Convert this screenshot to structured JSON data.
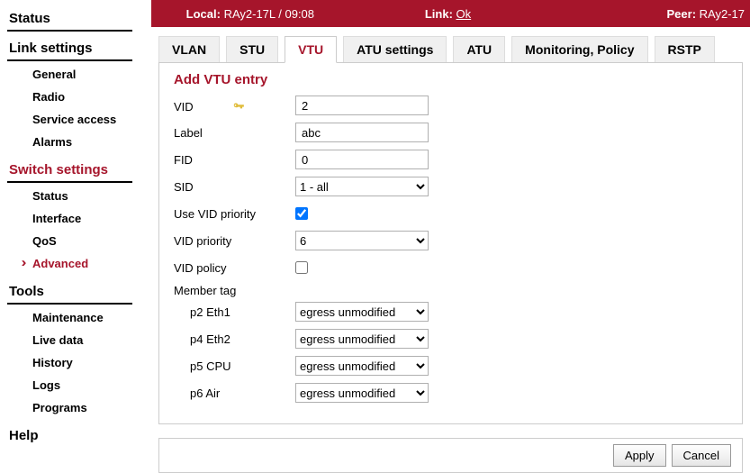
{
  "topbar": {
    "local_label": "Local:",
    "local_value": "RAy2-17L / 09:08",
    "link_label": "Link:",
    "link_value": "Ok",
    "peer_label": "Peer:",
    "peer_value": "RAy2-17"
  },
  "sidebar": {
    "status": "Status",
    "link_settings": "Link settings",
    "link_items": {
      "general": "General",
      "radio": "Radio",
      "service": "Service access",
      "alarms": "Alarms"
    },
    "switch_settings": "Switch settings",
    "switch_items": {
      "status": "Status",
      "interface": "Interface",
      "qos": "QoS",
      "advanced": "Advanced"
    },
    "tools": "Tools",
    "tool_items": {
      "maintenance": "Maintenance",
      "live": "Live data",
      "history": "History",
      "logs": "Logs",
      "programs": "Programs"
    },
    "help": "Help"
  },
  "tabs": {
    "vlan": "VLAN",
    "stu": "STU",
    "vtu": "VTU",
    "atu_settings": "ATU settings",
    "atu": "ATU",
    "monitoring": "Monitoring, Policy",
    "rstp": "RSTP"
  },
  "form": {
    "title": "Add VTU entry",
    "vid_label": "VID",
    "vid_value": "2",
    "label_label": "Label",
    "label_value": "abc",
    "fid_label": "FID",
    "fid_value": "0",
    "sid_label": "SID",
    "sid_value": "1 - all",
    "use_vid_prio_label": "Use VID priority",
    "vid_prio_label": "VID priority",
    "vid_prio_value": "6",
    "vid_policy_label": "VID policy",
    "member_tag_label": "Member tag",
    "ports": {
      "p2": {
        "label": "p2 Eth1",
        "value": "egress unmodified"
      },
      "p4": {
        "label": "p4 Eth2",
        "value": "egress unmodified"
      },
      "p5": {
        "label": "p5 CPU",
        "value": "egress unmodified"
      },
      "p6": {
        "label": "p6 Air",
        "value": "egress unmodified"
      }
    }
  },
  "buttons": {
    "apply": "Apply",
    "cancel": "Cancel"
  }
}
